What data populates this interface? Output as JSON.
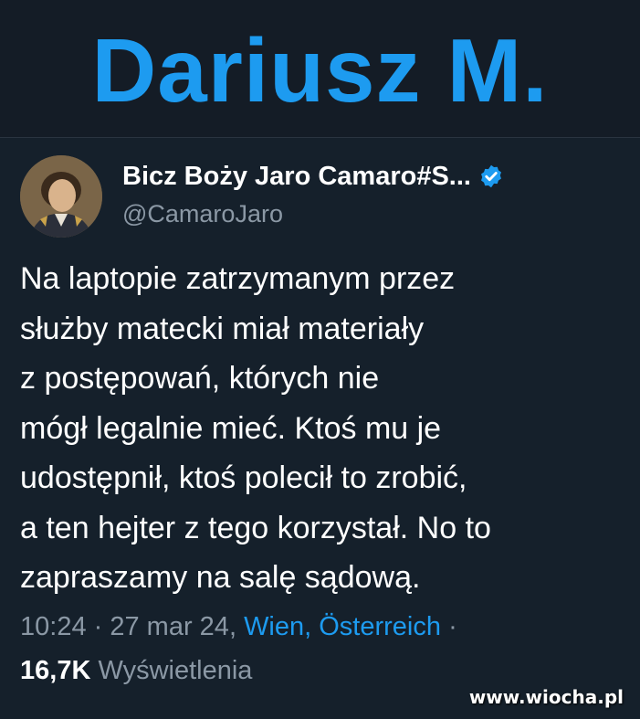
{
  "banner": {
    "title": "Dariusz M."
  },
  "tweet": {
    "display_name": "Bicz Boży Jaro Camaro#S...",
    "handle": "@CamaroJaro",
    "text_lines": [
      "Na laptopie zatrzymanym przez",
      "służby matecki miał materiały",
      "z postępowań, których nie",
      "mógł legalnie mieć. Ktoś mu je",
      "udostępnił, ktoś polecił to zrobić,",
      "a ten hejter z tego korzystał. No to",
      "zapraszamy na salę sądową."
    ],
    "time": "10:24",
    "separator": " · ",
    "date": "27 mar 24",
    "comma": ", ",
    "location": "Wien, Österreich",
    "trailing_dot": " ·",
    "views_count": "16,7K",
    "views_label": " Wyświetlenia"
  },
  "icons": {
    "verified": "verified-badge-icon",
    "avatar": "portrait-avatar"
  },
  "colors": {
    "accent": "#1d9bf0",
    "background": "#15202b",
    "muted": "#8b98a5"
  },
  "watermark": "www.wiocha.pl"
}
